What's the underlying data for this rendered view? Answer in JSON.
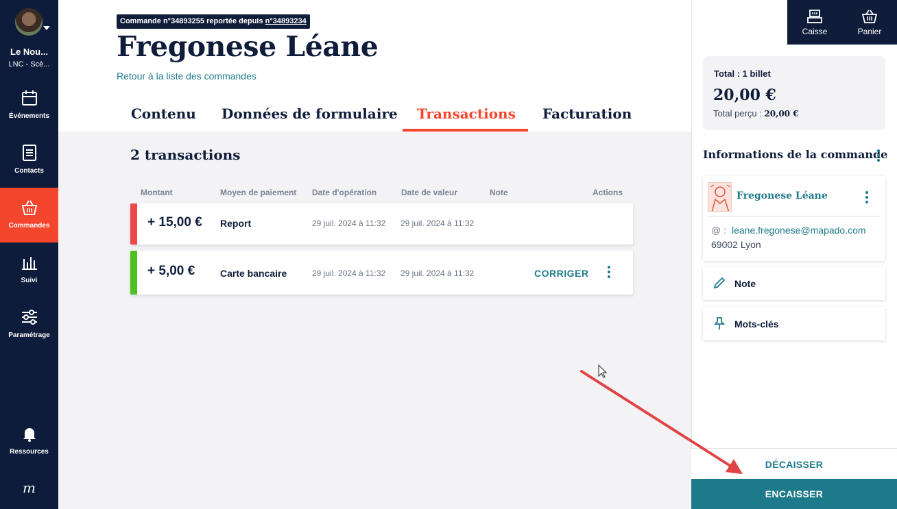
{
  "sidebar": {
    "org_name": "Le Nou...",
    "org_sub": "LNC - Scè...",
    "items": [
      {
        "label": "Événements",
        "icon": "calendar-icon"
      },
      {
        "label": "Contacts",
        "icon": "document-icon"
      },
      {
        "label": "Commandes",
        "icon": "basket-icon",
        "active": true
      },
      {
        "label": "Suivi",
        "icon": "bar-chart-icon"
      },
      {
        "label": "Paramétrage",
        "icon": "sliders-icon"
      }
    ],
    "resources_label": "Ressources",
    "logo": "m"
  },
  "order": {
    "badge_prefix": "Commande n°34893255 reportée depuis ",
    "badge_ref": "n°34893234",
    "title": "Fregonese Léane",
    "back_link": "Retour à la liste des commandes"
  },
  "tabs": [
    {
      "label": "Contenu"
    },
    {
      "label": "Données de formulaire"
    },
    {
      "label": "Transactions",
      "active": true
    },
    {
      "label": "Facturation"
    }
  ],
  "transactions": {
    "count_title": "2 transactions",
    "columns": [
      "Montant",
      "Moyen de paiement",
      "Date d'opération",
      "Date de valeur",
      "Note",
      "Actions"
    ],
    "rows": [
      {
        "amount": "+ 15,00 €",
        "method": "Report",
        "op_date": "29 juil. 2024 à 11:32",
        "value_date": "29 juil. 2024 à 11:32",
        "status_color": "#f0474a"
      },
      {
        "amount": "+ 5,00 €",
        "method": "Carte bancaire",
        "op_date": "29 juil. 2024 à 11:32",
        "value_date": "29 juil. 2024 à 11:32",
        "action": "CORRIGER",
        "status_color": "#4cc21e"
      }
    ]
  },
  "topbar": {
    "caisse": "Caisse",
    "panier": "Panier"
  },
  "summary": {
    "total_title": "Total : 1 billet",
    "total_amount": "20,00 €",
    "received_label": "Total perçu : ",
    "received_value": "20,00 €"
  },
  "order_info": {
    "title": "Informations de la commande",
    "customer_name": "Fregonese Léane",
    "email_prefix": "@ :",
    "email": "leane.fregonese@mapado.com",
    "city": "69002 Lyon",
    "note_label": "Note",
    "keywords_label": "Mots-clés"
  },
  "actions": {
    "decaisser": "DÉCAISSER",
    "encaisser": "ENCAISSER"
  },
  "colors": {
    "sidebar_bg": "#0d1c3a",
    "accent": "#f4452d",
    "teal": "#1d7a8a",
    "annotation_arrow": "#e04444"
  }
}
